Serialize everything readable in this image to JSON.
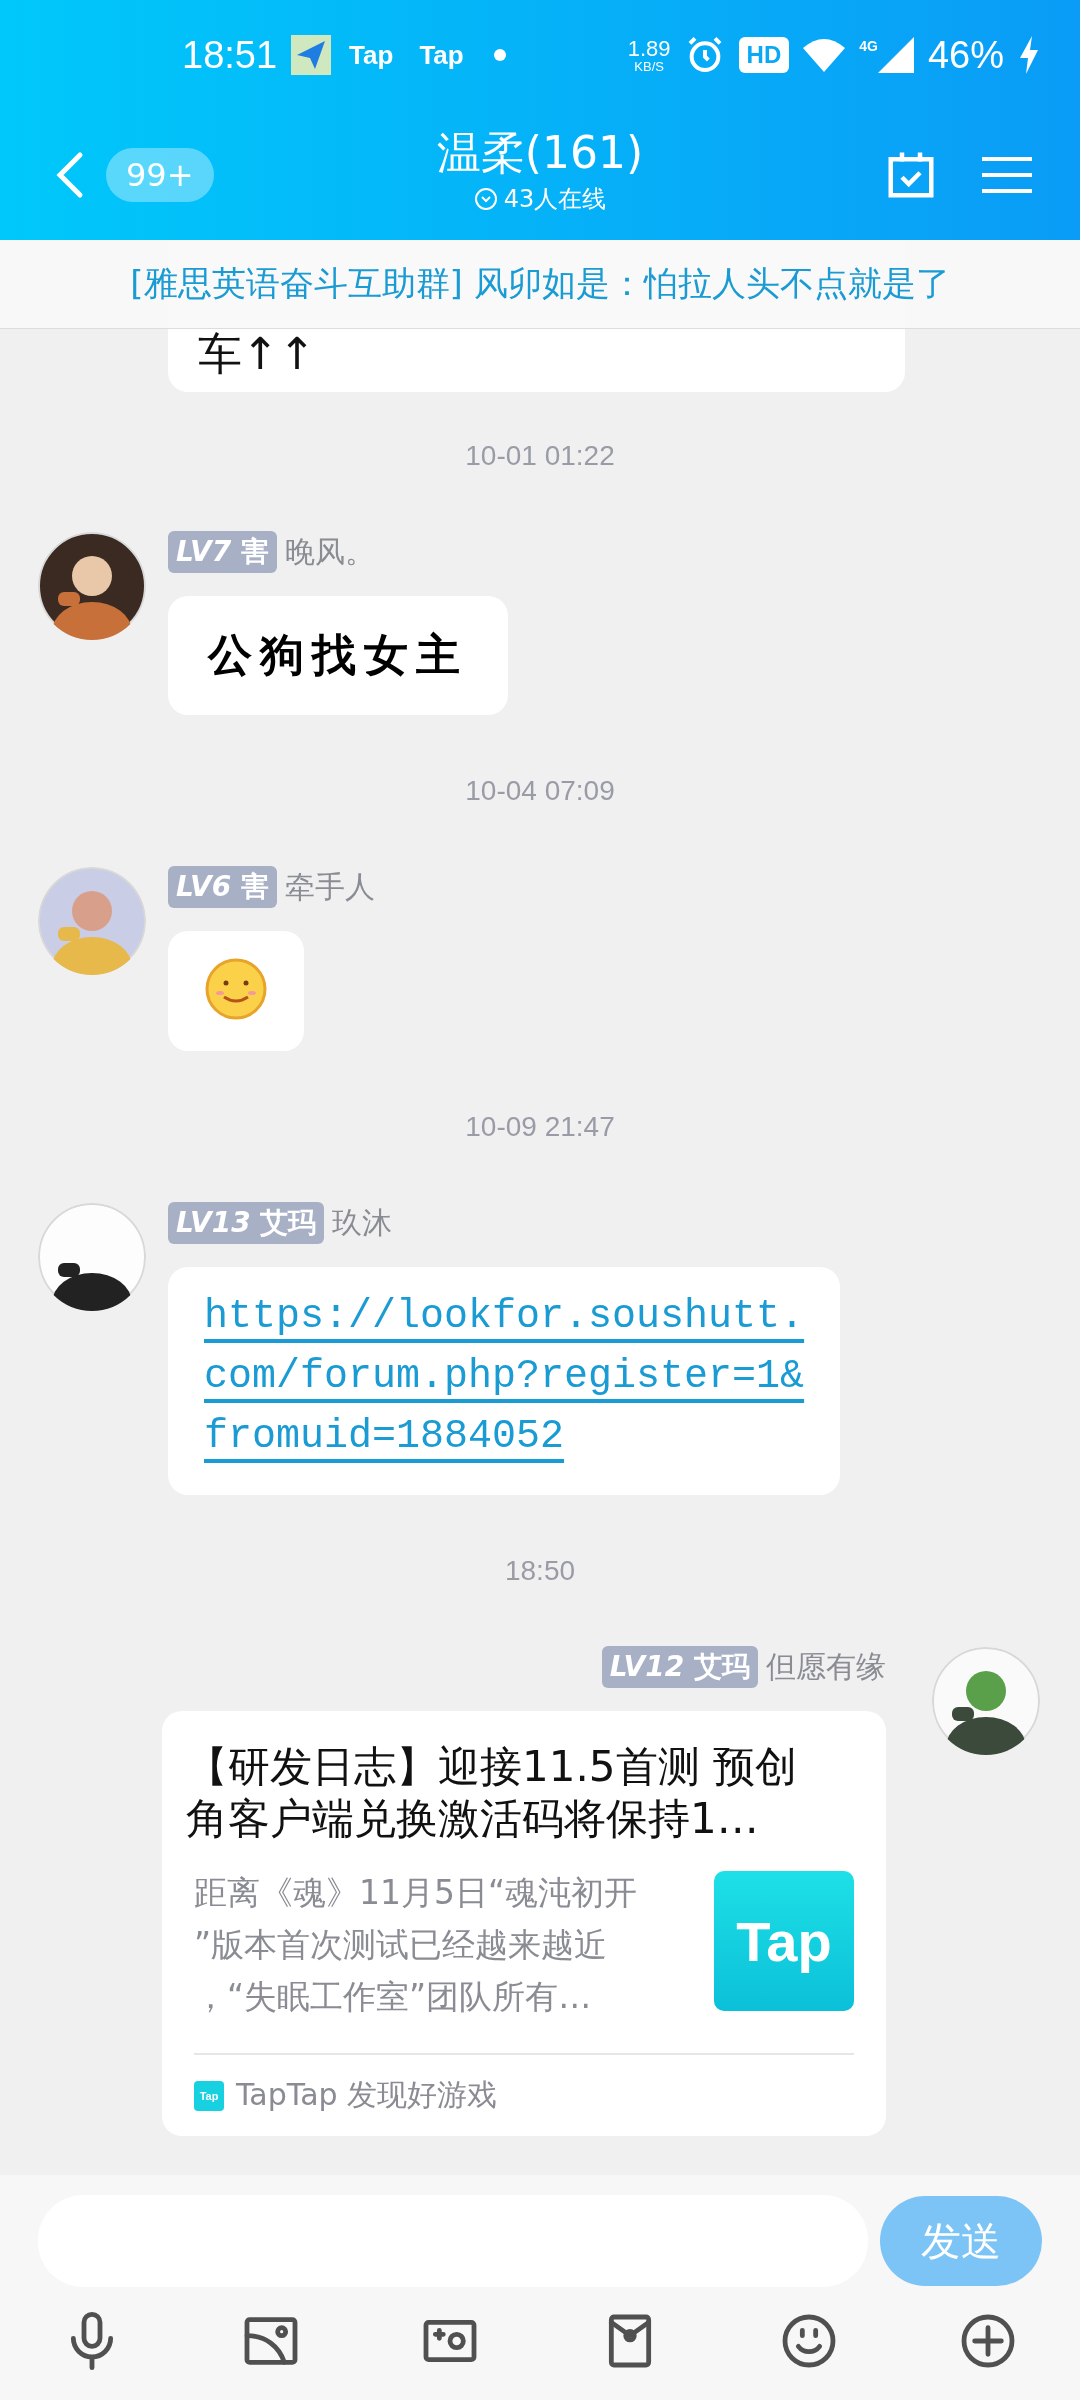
{
  "status_bar": {
    "time": "18:51",
    "notifications": [
      "Tap",
      "Tap"
    ],
    "speed": "1.89",
    "speed_unit": "KB/S",
    "hd": "HD",
    "network": "4G",
    "battery": "46%"
  },
  "header": {
    "back_badge": "99+",
    "title": "温柔(161)",
    "online": "43人在线"
  },
  "banner": {
    "text": "[雅思英语奋斗互助群] 风卯如是：怕拉人头不点就是了"
  },
  "messages": [
    {
      "kind": "partial",
      "text": "车↑↑"
    },
    {
      "kind": "time",
      "text": "10-01 01:22"
    },
    {
      "kind": "sticker",
      "mine": false,
      "badge": "*LV7* 害",
      "name": "晚风。",
      "text": "公狗找女主"
    },
    {
      "kind": "time",
      "text": "10-04 07:09"
    },
    {
      "kind": "emoji",
      "mine": false,
      "badge": "*LV6* 害",
      "name": "牵手人"
    },
    {
      "kind": "time",
      "text": "10-09 21:47"
    },
    {
      "kind": "link",
      "mine": false,
      "badge": "*LV13* 艾玛",
      "name": "玖沐",
      "text": "https://lookfor.soushutt.com/forum.php?register=1&fromuid=1884052"
    },
    {
      "kind": "time",
      "text": "18:50"
    },
    {
      "kind": "card",
      "mine": true,
      "badge": "*LV12* 艾玛",
      "name": "但愿有缘",
      "title_lines": [
        "【研发日志】迎接11.5首测 预创",
        "角客户端兑换激活码将保持1…"
      ],
      "desc_lines": [
        "距离《魂》11月5日“魂沌初开",
        "”版本首次测试已经越来越近",
        "，“失眠工作室”团队所有…"
      ],
      "logo": "Tap",
      "source_logo": "Tap",
      "source": "TapTap 发现好游戏"
    }
  ],
  "composer": {
    "send": "发送"
  }
}
